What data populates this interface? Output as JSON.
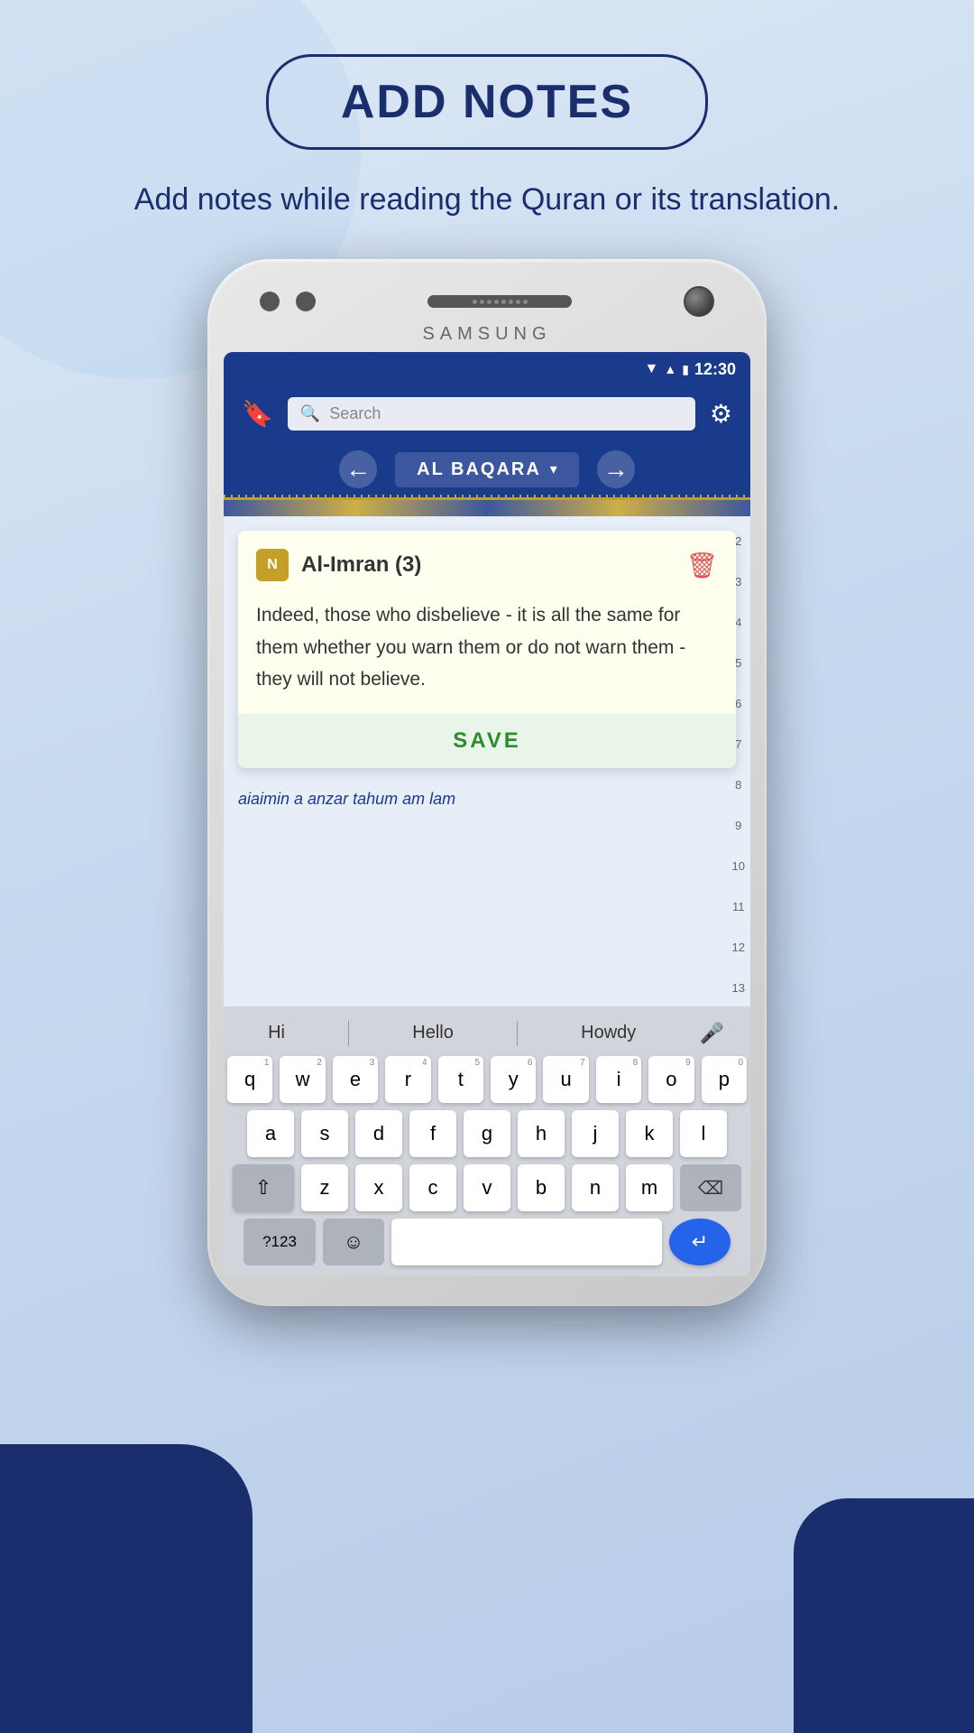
{
  "header": {
    "title": "ADD NOTES",
    "subtitle": "Add notes while reading the Quran or its translation."
  },
  "phone": {
    "brand": "SAMSUNG",
    "status_bar": {
      "time": "12:30"
    },
    "toolbar": {
      "search_placeholder": "Search"
    },
    "surah_nav": {
      "current_surah": "AL BAQARA"
    },
    "note_card": {
      "badge_letter": "N",
      "surah_title": "Al-Imran (3)",
      "content": "Indeed, those who disbelieve - it is all the same for them whether you warn them or do not warn them - they will not believe.",
      "save_label": "SAVE"
    },
    "arabic_text": "aiaimin a anzar tahum am lam",
    "keyboard": {
      "suggestions": [
        "Hi",
        "Hello",
        "Howdy"
      ],
      "rows": [
        [
          "q",
          "w",
          "e",
          "r",
          "t",
          "y",
          "u",
          "i",
          "o",
          "p"
        ],
        [
          "a",
          "s",
          "d",
          "f",
          "g",
          "h",
          "j",
          "k",
          "l"
        ],
        [
          "z",
          "x",
          "c",
          "v",
          "b",
          "n",
          "m"
        ]
      ],
      "num_row": [
        "1",
        "2",
        "3",
        "4",
        "5",
        "6",
        "7",
        "8",
        "9",
        "0"
      ],
      "bottom_labels": {
        "num_key": "?123",
        "comma": ",",
        "enter_icon": "↵"
      }
    }
  },
  "colors": {
    "primary_dark": "#1a2e6e",
    "primary_blue": "#1a3a8c",
    "gold": "#c5a028",
    "note_bg": "#fffff0",
    "save_green": "#2e8b2e",
    "trash_red": "#e05050"
  }
}
